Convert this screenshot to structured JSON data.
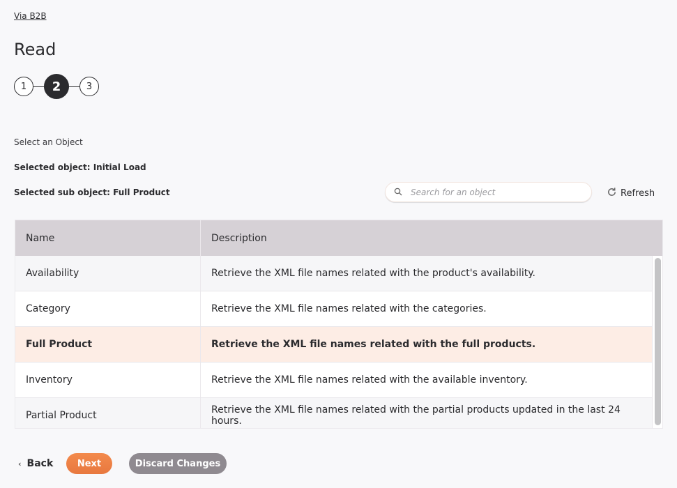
{
  "breadcrumb": "Via B2B",
  "title": "Read",
  "stepper": {
    "steps": [
      "1",
      "2",
      "3"
    ],
    "active_step": "2"
  },
  "labels": {
    "select_object": "Select an Object",
    "selected_object": "Selected object: Initial Load",
    "selected_sub_object": "Selected sub object: Full Product"
  },
  "search": {
    "placeholder": "Search for an object",
    "value": ""
  },
  "refresh_label": "Refresh",
  "table": {
    "columns": [
      "Name",
      "Description"
    ],
    "rows": [
      {
        "name": "Availability",
        "description": "Retrieve the XML file names related with the product's availability."
      },
      {
        "name": "Category",
        "description": "Retrieve the XML file names related with the categories."
      },
      {
        "name": "Full Product",
        "description": "Retrieve the XML file names related with the full products."
      },
      {
        "name": "Inventory",
        "description": "Retrieve the XML file names related with the available inventory."
      },
      {
        "name": "Partial Product",
        "description": "Retrieve the XML file names related with the partial products updated in the last 24 hours."
      }
    ],
    "selected_row": "Full Product"
  },
  "footer": {
    "back_label": "Back",
    "next_label": "Next",
    "discard_label": "Discard Changes"
  },
  "colors": {
    "accent": "#f08048",
    "selected_row_bg": "#fdede5",
    "header_bg": "#d6d1d6",
    "discard_bg": "#8f8a90"
  }
}
